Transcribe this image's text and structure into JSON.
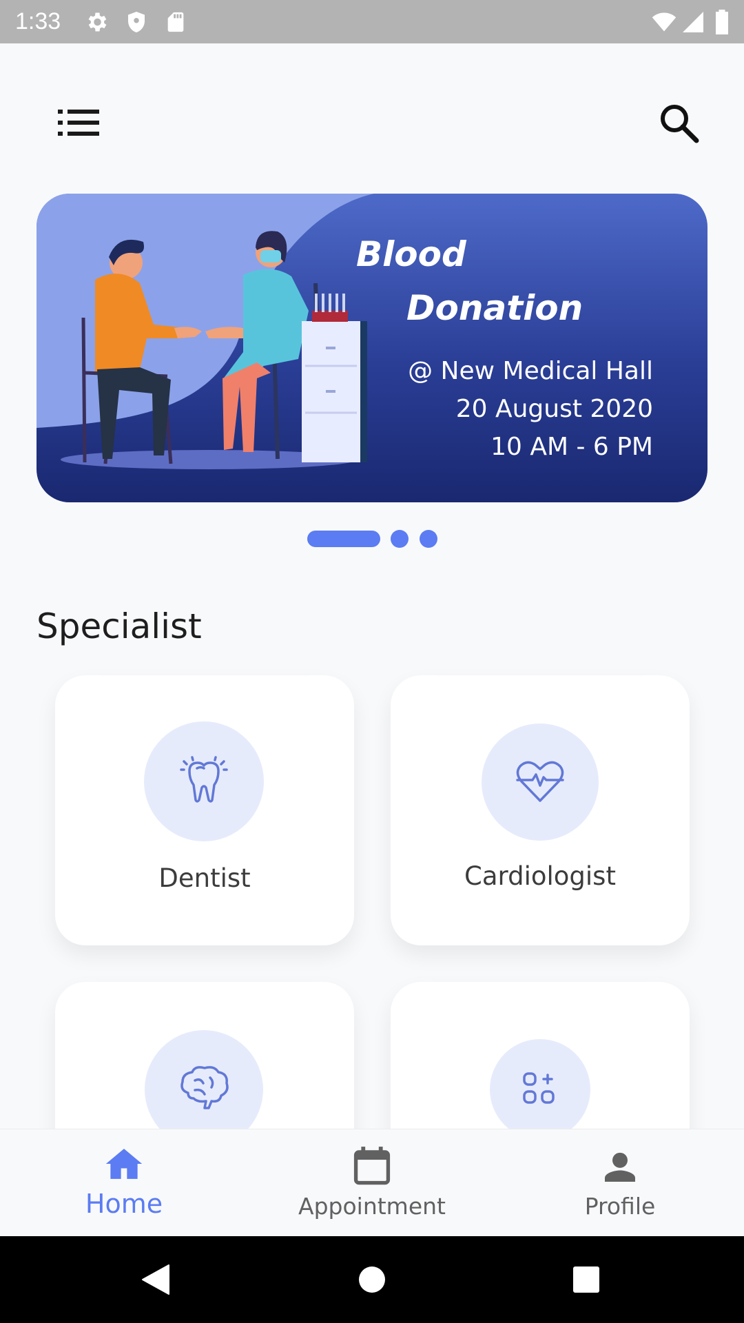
{
  "status_bar": {
    "time": "1:33",
    "icons": [
      "gear-icon",
      "shield-icon",
      "sd-card-icon",
      "wifi-icon",
      "signal-icon",
      "battery-icon"
    ]
  },
  "app_bar": {
    "menu_icon": "list-menu-icon",
    "search_icon": "search-icon"
  },
  "banner": {
    "title_line1": "Blood",
    "title_line2": "Donation",
    "venue": "@ New Medical Hall",
    "date": "20 August 2020",
    "time": "10 AM - 6 PM",
    "colors": {
      "top": "#4e6ac9",
      "bottom": "#1a2870"
    }
  },
  "pager": {
    "count": 3,
    "active_index": 0,
    "color": "#5b7cf2"
  },
  "specialist": {
    "title": "Specialist",
    "cards": [
      {
        "label": "Dentist",
        "icon": "tooth-icon"
      },
      {
        "label": "Cardiologist",
        "icon": "heart-pulse-icon"
      },
      {
        "label": "",
        "icon": "brain-icon"
      },
      {
        "label": "",
        "icon": "apps-icon"
      }
    ]
  },
  "bottom_nav": {
    "items": [
      {
        "label": "Home",
        "icon": "home-icon",
        "active": true
      },
      {
        "label": "Appointment",
        "icon": "calendar-icon",
        "active": false
      },
      {
        "label": "Profile",
        "icon": "person-icon",
        "active": false
      }
    ],
    "active_color": "#5b7cf2",
    "inactive_color": "#616161"
  },
  "system_nav": {
    "icons": [
      "back-icon",
      "home-circle-icon",
      "recents-icon"
    ]
  }
}
